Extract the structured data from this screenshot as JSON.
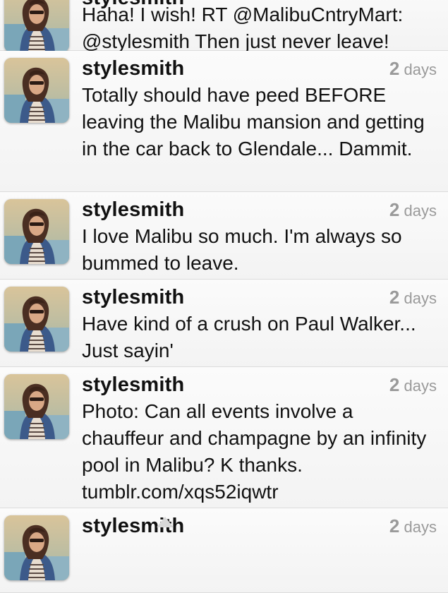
{
  "timeline": {
    "tweets": [
      {
        "username": "stylesmith",
        "time_num": "",
        "time_unit": "",
        "text": "Haha! I wish! RT @MalibuCntryMart: @stylesmith Then just never leave!"
      },
      {
        "username": "stylesmith",
        "time_num": "2",
        "time_unit": "days",
        "text": "Totally should have peed BEFORE leaving the Malibu mansion and getting in the car back to Glendale... Dammit."
      },
      {
        "username": "stylesmith",
        "time_num": "2",
        "time_unit": "days",
        "text": "I love Malibu so much. I'm always so bummed to leave."
      },
      {
        "username": "stylesmith",
        "time_num": "2",
        "time_unit": "days",
        "text": "Have kind of a crush on Paul Walker... Just sayin'"
      },
      {
        "username": "stylesmith",
        "time_num": "2",
        "time_unit": "days",
        "text": "Photo: Can all events involve a chauffeur and champagne by an infinity pool in Malibu? K thanks. tumblr.com/xqs52iqwtr"
      },
      {
        "username": "stylesmith",
        "time_num": "2",
        "time_unit": "days",
        "text": ""
      }
    ]
  }
}
